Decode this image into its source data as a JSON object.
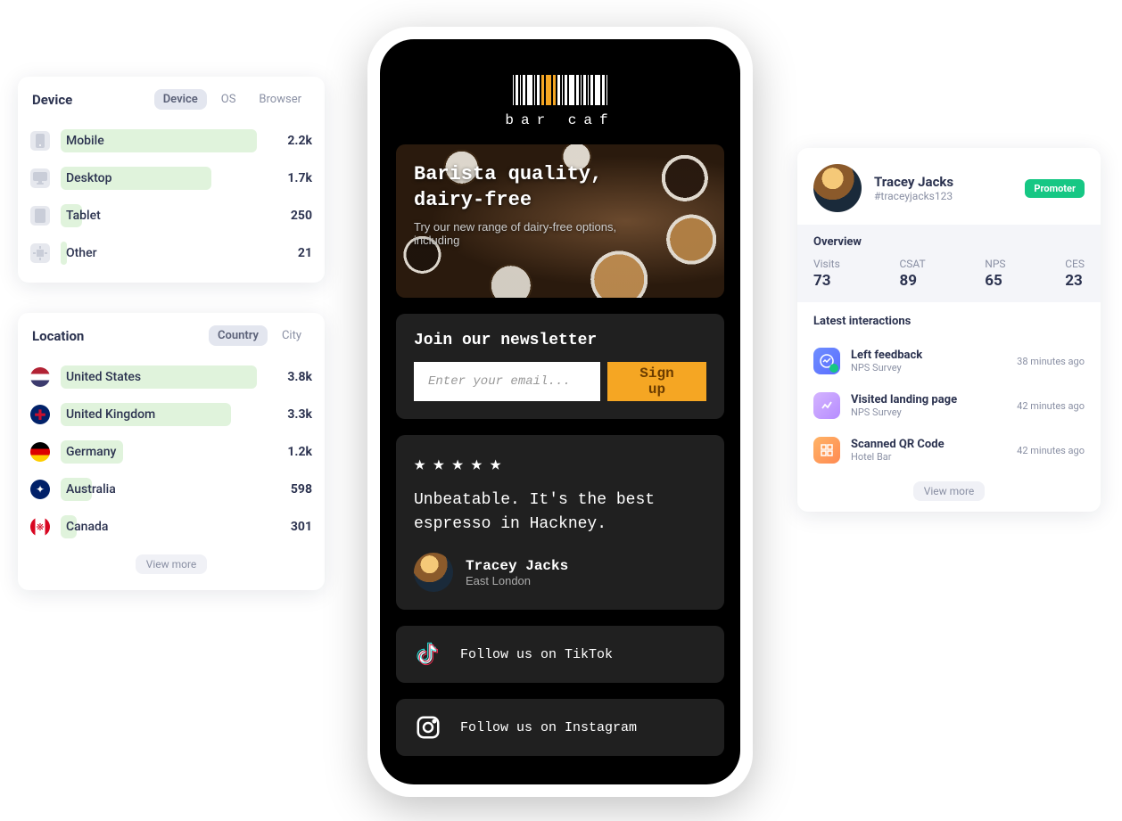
{
  "chart_data": [
    {
      "type": "bar",
      "title": "Device",
      "categories": [
        "Mobile",
        "Desktop",
        "Tablet",
        "Other"
      ],
      "values": [
        2200,
        1700,
        250,
        21
      ]
    },
    {
      "type": "bar",
      "title": "Location",
      "categories": [
        "United States",
        "United Kingdom",
        "Germany",
        "Australia",
        "Canada"
      ],
      "values": [
        3800,
        3300,
        1200,
        598,
        301
      ]
    }
  ],
  "device": {
    "title": "Device",
    "tabs": {
      "device": "Device",
      "os": "OS",
      "browser": "Browser"
    },
    "rows": [
      {
        "label": "Mobile",
        "value": "2.2k",
        "fill": 100
      },
      {
        "label": "Desktop",
        "value": "1.7k",
        "fill": 77
      },
      {
        "label": "Tablet",
        "value": "250",
        "fill": 11
      },
      {
        "label": "Other",
        "value": "21",
        "fill": 3
      }
    ]
  },
  "location": {
    "title": "Location",
    "tabs": {
      "country": "Country",
      "city": "City"
    },
    "rows": [
      {
        "label": "United States",
        "value": "3.8k",
        "fill": 100
      },
      {
        "label": "United Kingdom",
        "value": "3.3k",
        "fill": 87
      },
      {
        "label": "Germany",
        "value": "1.2k",
        "fill": 32
      },
      {
        "label": "Australia",
        "value": "598",
        "fill": 16
      },
      {
        "label": "Canada",
        "value": "301",
        "fill": 8
      }
    ],
    "view_more": "View more"
  },
  "phone": {
    "brand": "bar caf",
    "hero": {
      "title_l1": "Barista quality,",
      "title_l2": "dairy-free",
      "subtitle": "Try our new range of dairy-free options, including"
    },
    "newsletter": {
      "title": "Join our newsletter",
      "placeholder": "Enter your email...",
      "button": "Sign up"
    },
    "review": {
      "quote": "Unbeatable. It's the best espresso in Hackney.",
      "name": "Tracey Jacks",
      "location": "East London"
    },
    "social": {
      "tiktok": "Follow us on TikTok",
      "instagram": "Follow us on Instagram"
    }
  },
  "profile": {
    "name": "Tracey Jacks",
    "handle": "#traceyjacks123",
    "badge": "Promoter",
    "overview_title": "Overview",
    "stats": {
      "visits": {
        "label": "Visits",
        "value": "73"
      },
      "csat": {
        "label": "CSAT",
        "value": "89"
      },
      "nps": {
        "label": "NPS",
        "value": "65"
      },
      "ces": {
        "label": "CES",
        "value": "23"
      }
    },
    "interactions_title": "Latest interactions",
    "interactions": [
      {
        "title": "Left feedback",
        "sub": "NPS Survey",
        "time": "38 minutes ago"
      },
      {
        "title": "Visited landing page",
        "sub": "NPS Survey",
        "time": "42 minutes ago"
      },
      {
        "title": "Scanned QR Code",
        "sub": "Hotel Bar",
        "time": "42 minutes ago"
      }
    ],
    "view_more": "View more"
  }
}
